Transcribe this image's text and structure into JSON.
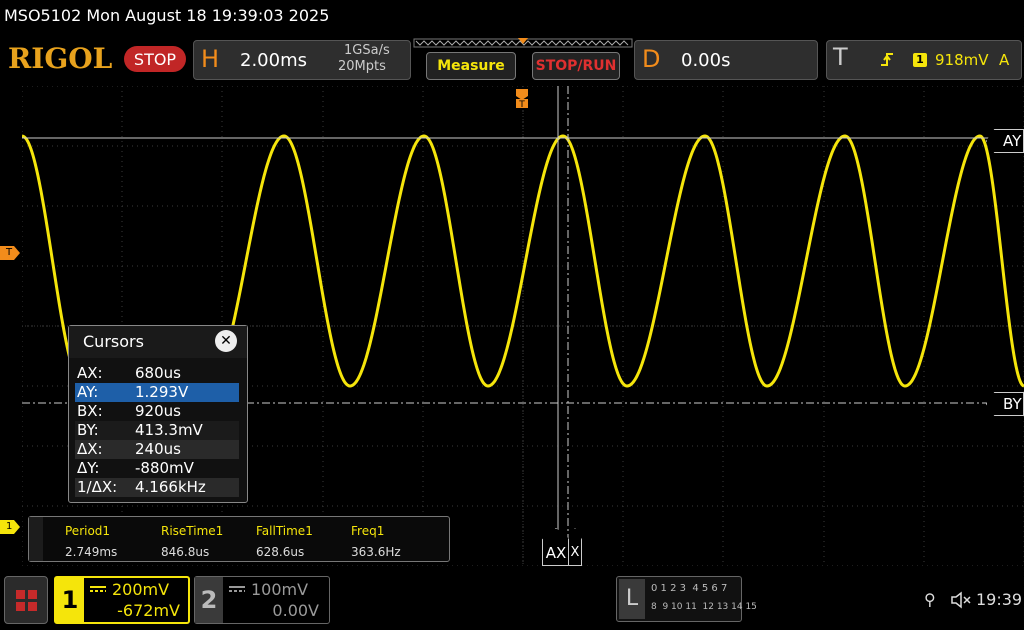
{
  "title_bar": "MSO5102  Mon August 18 19:39:03 2025",
  "brand": "RIGOL",
  "run_state": "STOP",
  "horizontal": {
    "tag": "H",
    "timebase": "2.00ms",
    "sample_rate": "1GSa/s",
    "memory_depth": "20Mpts"
  },
  "buttons": {
    "measure": "Measure",
    "stop_run": "STOP/RUN"
  },
  "delay": {
    "tag": "D",
    "value": "0.00s"
  },
  "trigger": {
    "tag": "T",
    "slope_icon": "rising-edge-icon",
    "source": "1",
    "level": "918mV",
    "mode": "A"
  },
  "markers": {
    "trigger_left": "T",
    "ch1_ground": "1",
    "cursor_ay": "AY",
    "cursor_by": "BY",
    "cursor_ax": "AX",
    "cursor_bx": "X"
  },
  "cursors_panel": {
    "title": "Cursors",
    "close_icon": "close-icon",
    "rows": [
      {
        "key": "AX:",
        "value": "680us"
      },
      {
        "key": "AY:",
        "value": "1.293V"
      },
      {
        "key": "BX:",
        "value": "920us"
      },
      {
        "key": "BY:",
        "value": "413.3mV"
      },
      {
        "key": "ΔX:",
        "value": "240us"
      },
      {
        "key": "ΔY:",
        "value": "-880mV"
      },
      {
        "key": "1/ΔX:",
        "value": "4.166kHz"
      }
    ]
  },
  "measurements": [
    {
      "label": "Period1",
      "value": "2.749ms"
    },
    {
      "label": "RiseTime1",
      "value": "846.8us"
    },
    {
      "label": "FallTime1",
      "value": "628.6us"
    },
    {
      "label": "Freq1",
      "value": "363.6Hz"
    }
  ],
  "channels": [
    {
      "num": "1",
      "scale": "200mV",
      "offset": "-672mV",
      "color": "#f5e50b"
    },
    {
      "num": "2",
      "scale": "100mV",
      "offset": "0.00V",
      "color": "#9a9a9a"
    }
  ],
  "logic": {
    "tag": "L",
    "row1": "0 1 2 3  4 5 6 7",
    "row2": "8  9 10 11  12 13 14 15"
  },
  "clock": "19:39",
  "colors": {
    "accent": "#f28c1b",
    "ch1": "#f5e50b",
    "stop": "#c12626",
    "selected_row": "#1e5fa8"
  }
}
